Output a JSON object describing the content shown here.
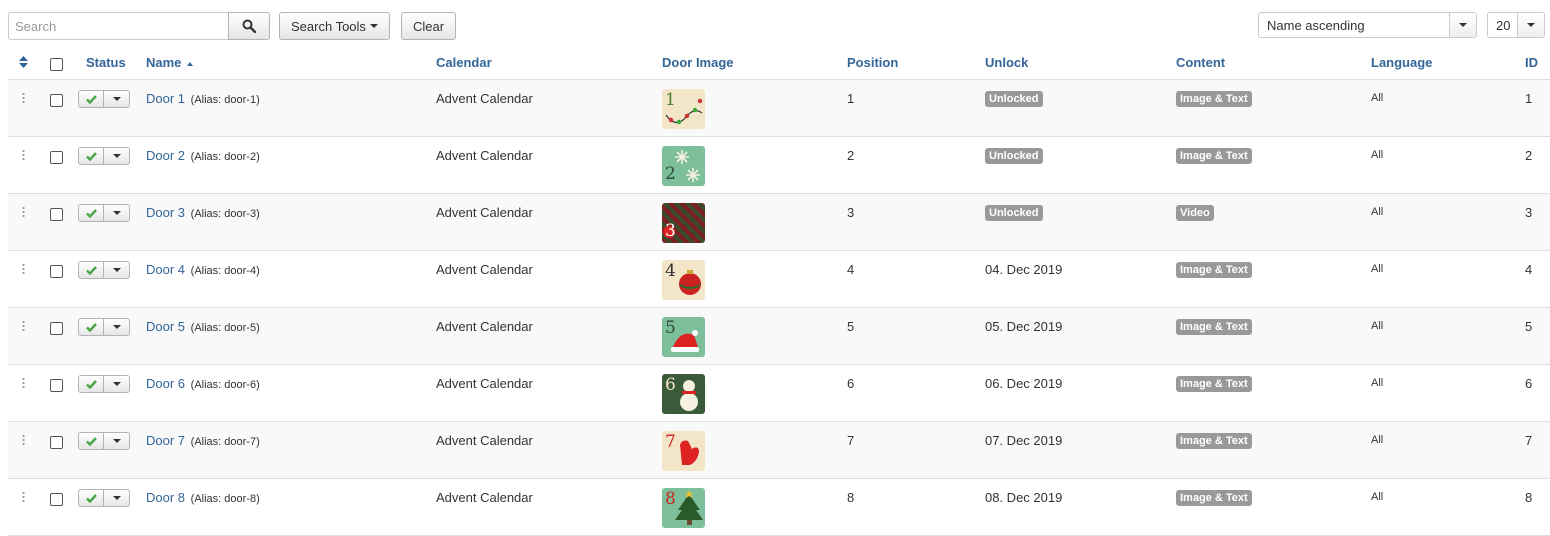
{
  "toolbar": {
    "search_placeholder": "Search",
    "search_tools_label": "Search Tools",
    "clear_label": "Clear",
    "sort_value": "Name ascending",
    "limit_value": "20"
  },
  "columns": {
    "status": "Status",
    "name": "Name",
    "calendar": "Calendar",
    "door_image": "Door Image",
    "position": "Position",
    "unlock": "Unlock",
    "content": "Content",
    "language": "Language",
    "id": "ID"
  },
  "rows": [
    {
      "name": "Door 1",
      "alias": "(Alias: door-1)",
      "calendar": "Advent Calendar",
      "image_num": "1",
      "image_icon": "string-lights-icon",
      "position": "1",
      "unlock": "Unlocked",
      "unlock_is_badge": true,
      "content": "Image & Text",
      "language": "All",
      "id": "1"
    },
    {
      "name": "Door 2",
      "alias": "(Alias: door-2)",
      "calendar": "Advent Calendar",
      "image_num": "2",
      "image_icon": "snowflake-icon",
      "position": "2",
      "unlock": "Unlocked",
      "unlock_is_badge": true,
      "content": "Image & Text",
      "language": "All",
      "id": "2"
    },
    {
      "name": "Door 3",
      "alias": "(Alias: door-3)",
      "calendar": "Advent Calendar",
      "image_num": "3",
      "image_icon": "striped-pattern-icon",
      "position": "3",
      "unlock": "Unlocked",
      "unlock_is_badge": true,
      "content": "Video",
      "language": "All",
      "id": "3"
    },
    {
      "name": "Door 4",
      "alias": "(Alias: door-4)",
      "calendar": "Advent Calendar",
      "image_num": "4",
      "image_icon": "bauble-icon",
      "position": "4",
      "unlock": "04. Dec 2019",
      "unlock_is_badge": false,
      "content": "Image & Text",
      "language": "All",
      "id": "4"
    },
    {
      "name": "Door 5",
      "alias": "(Alias: door-5)",
      "calendar": "Advent Calendar",
      "image_num": "5",
      "image_icon": "santa-hat-icon",
      "position": "5",
      "unlock": "05. Dec 2019",
      "unlock_is_badge": false,
      "content": "Image & Text",
      "language": "All",
      "id": "5"
    },
    {
      "name": "Door 6",
      "alias": "(Alias: door-6)",
      "calendar": "Advent Calendar",
      "image_num": "6",
      "image_icon": "snowman-icon",
      "position": "6",
      "unlock": "06. Dec 2019",
      "unlock_is_badge": false,
      "content": "Image & Text",
      "language": "All",
      "id": "6"
    },
    {
      "name": "Door 7",
      "alias": "(Alias: door-7)",
      "calendar": "Advent Calendar",
      "image_num": "7",
      "image_icon": "mitten-icon",
      "position": "7",
      "unlock": "07. Dec 2019",
      "unlock_is_badge": false,
      "content": "Image & Text",
      "language": "All",
      "id": "7"
    },
    {
      "name": "Door 8",
      "alias": "(Alias: door-8)",
      "calendar": "Advent Calendar",
      "image_num": "8",
      "image_icon": "christmas-tree-icon",
      "position": "8",
      "unlock": "08. Dec 2019",
      "unlock_is_badge": false,
      "content": "Image & Text",
      "language": "All",
      "id": "8"
    }
  ],
  "colors": {
    "link": "#336699",
    "badge": "#999999",
    "check": "#46a546",
    "row_stripe": "#f9f9f9"
  }
}
